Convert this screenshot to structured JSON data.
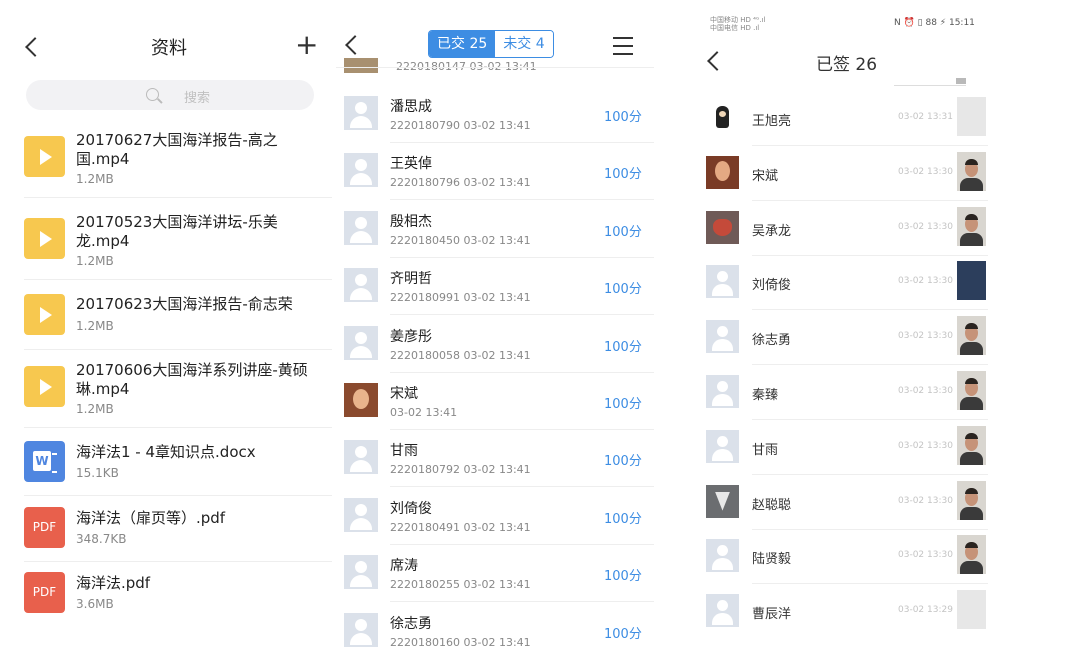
{
  "materials": {
    "status_fragment": "",
    "title": "资料",
    "search_placeholder": "搜索",
    "files": [
      {
        "name": "20170627大国海洋报告-高之国.mp4",
        "size": "1.2MB",
        "type": "video"
      },
      {
        "name": "20170523大国海洋讲坛-乐美龙.mp4",
        "size": "1.2MB",
        "type": "video"
      },
      {
        "name": "20170623大国海洋报告-俞志荣",
        "size": "1.2MB",
        "type": "video"
      },
      {
        "name": "20170606大国海洋系列讲座-黄硕琳.mp4",
        "size": "1.2MB",
        "type": "video"
      },
      {
        "name": "海洋法1 - 4章知识点.docx",
        "size": "15.1KB",
        "type": "word",
        "icon_label": "W"
      },
      {
        "name": "海洋法（扉页等）.pdf",
        "size": "348.7KB",
        "type": "pdf",
        "icon_label": "PDF"
      },
      {
        "name": "海洋法.pdf",
        "size": "3.6MB",
        "type": "pdf",
        "icon_label": "PDF"
      }
    ]
  },
  "submissions": {
    "tab_submitted": "已交 25",
    "tab_unsubmitted": "未交 4",
    "partial_row_text": "2220180147   03-02 13:41",
    "rows": [
      {
        "name": "潘思成",
        "meta": "2220180790   03-02 13:41",
        "score": "100分",
        "avatar": "default"
      },
      {
        "name": "王英倬",
        "meta": "2220180796   03-02 13:41",
        "score": "100分",
        "avatar": "default"
      },
      {
        "name": "殷相杰",
        "meta": "2220180450   03-02 13:41",
        "score": "100分",
        "avatar": "default"
      },
      {
        "name": "齐明哲",
        "meta": "2220180991   03-02 13:41",
        "score": "100分",
        "avatar": "default"
      },
      {
        "name": "姜彦彤",
        "meta": "2220180058   03-02 13:41",
        "score": "100分",
        "avatar": "default"
      },
      {
        "name": "宋斌",
        "meta": "03-02 13:41",
        "score": "100分",
        "avatar": "photo"
      },
      {
        "name": "甘雨",
        "meta": "2220180792   03-02 13:41",
        "score": "100分",
        "avatar": "default"
      },
      {
        "name": "刘倚俊",
        "meta": "2220180491   03-02 13:41",
        "score": "100分",
        "avatar": "default"
      },
      {
        "name": "席涛",
        "meta": "2220180255   03-02 13:41",
        "score": "100分",
        "avatar": "default"
      },
      {
        "name": "徐志勇",
        "meta": "2220180160   03-02 13:41",
        "score": "100分",
        "avatar": "default"
      }
    ]
  },
  "signin": {
    "status_left_line1": "中国移动 HD ⁴ᴳ.ıl",
    "status_left_line2": "中国电信 HD .ıl",
    "status_right": "N ⏰ ▯ 88 ⚡ 15:11",
    "title": "已签 26",
    "rows": [
      {
        "name": "王旭亮",
        "time": "03-02 13:31",
        "avatar": "c1",
        "photo": "light"
      },
      {
        "name": "宋斌",
        "time": "03-02 13:30",
        "avatar": "c2",
        "photo": "face"
      },
      {
        "name": "吴承龙",
        "time": "03-02 13:30",
        "avatar": "c3",
        "photo": "face"
      },
      {
        "name": "刘倚俊",
        "time": "03-02 13:30",
        "avatar": "default",
        "photo": "screen"
      },
      {
        "name": "徐志勇",
        "time": "03-02 13:30",
        "avatar": "default",
        "photo": "face"
      },
      {
        "name": "秦臻",
        "time": "03-02 13:30",
        "avatar": "default",
        "photo": "face"
      },
      {
        "name": "甘雨",
        "time": "03-02 13:30",
        "avatar": "default",
        "photo": "face"
      },
      {
        "name": "赵聪聪",
        "time": "03-02 13:30",
        "avatar": "c4",
        "photo": "face"
      },
      {
        "name": "陆贤毅",
        "time": "03-02 13:30",
        "avatar": "default",
        "photo": "face"
      },
      {
        "name": "曹辰洋",
        "time": "03-02 13:29",
        "avatar": "default",
        "photo": "light"
      }
    ]
  },
  "colors": {
    "accent": "#3d8de3",
    "video": "#f7c84f",
    "word": "#4f86e0",
    "pdf": "#e8604c"
  }
}
